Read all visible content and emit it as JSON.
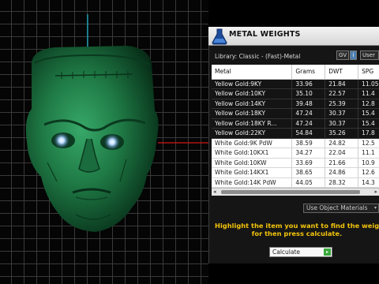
{
  "panel": {
    "title": "METAL WEIGHTS",
    "library_label": "Library: Classic - (Fast)-Metal",
    "gv_label": "GV",
    "info_label": "i",
    "user_label": "User",
    "hint_line1": "Highlight the item you want to find the weight",
    "hint_line2": "for then press calculate.",
    "object_materials": "Use Object Materials",
    "calculate_label": "Calculate",
    "calculate_arrow": "▸"
  },
  "table": {
    "columns": [
      "Metal",
      "Grams",
      "DWT",
      "SPG"
    ],
    "rows": [
      {
        "metal": "Yellow Gold:9KY",
        "grams": "33.96",
        "dwt": "21.84",
        "spg": "11.05"
      },
      {
        "metal": "Yellow Gold:10KY",
        "grams": "35.10",
        "dwt": "22.57",
        "spg": "11.4"
      },
      {
        "metal": "Yellow Gold:14KY",
        "grams": "39.48",
        "dwt": "25.39",
        "spg": "12.8"
      },
      {
        "metal": "Yellow Gold:18KY",
        "grams": "47.24",
        "dwt": "30.37",
        "spg": "15.4"
      },
      {
        "metal": "Yellow Gold:18KY R...",
        "grams": "47.24",
        "dwt": "30.37",
        "spg": "15.4"
      },
      {
        "metal": "Yellow Gold:22KY",
        "grams": "54.84",
        "dwt": "35.26",
        "spg": "17.8"
      },
      {
        "metal": "White Gold:9K PdW",
        "grams": "38.59",
        "dwt": "24.82",
        "spg": "12.5"
      },
      {
        "metal": "White Gold:10KX1",
        "grams": "34.27",
        "dwt": "22.04",
        "spg": "11.1"
      },
      {
        "metal": "White Gold:10KW",
        "grams": "33.69",
        "dwt": "21.66",
        "spg": "10.9"
      },
      {
        "metal": "White Gold:14KX1",
        "grams": "38.65",
        "dwt": "24.86",
        "spg": "12.6"
      },
      {
        "metal": "White Gold:14K PdW",
        "grams": "44.05",
        "dwt": "28.32",
        "spg": "14.3"
      }
    ]
  },
  "icons": {
    "logo": "flask-logo-icon",
    "scroll_left": "◂",
    "scroll_right": "▸",
    "dropdown": "▾"
  },
  "colors": {
    "model_green": "#1f7a45",
    "hint_yellow": "#f2c40c",
    "eye_glow": "#9fc8ff",
    "axis_red": "#d01818",
    "axis_cyan": "#18b8d0"
  }
}
